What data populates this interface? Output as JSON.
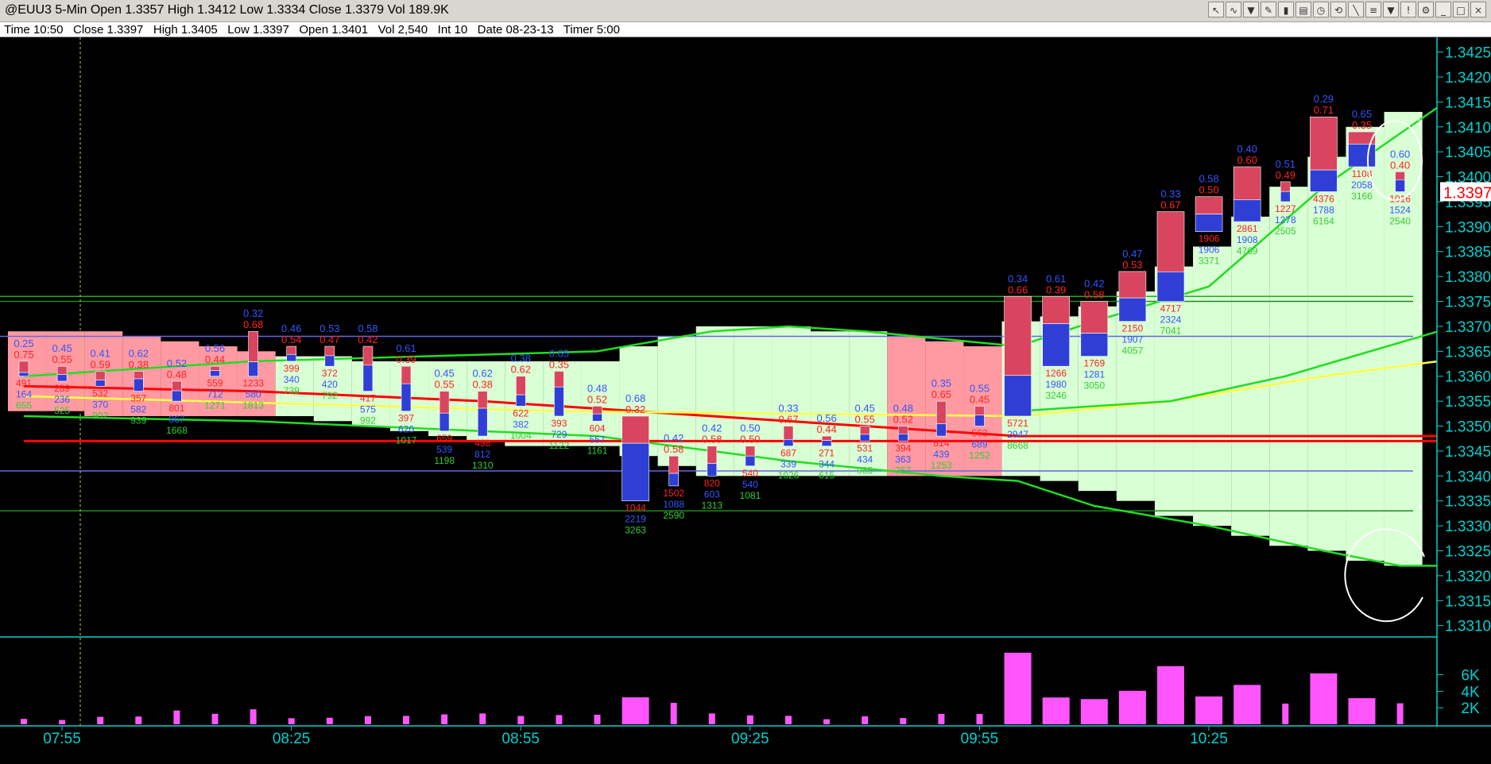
{
  "window": {
    "title": "@EUU3 5-Min Open 1.3357 High 1.3412 Low 1.3334 Close 1.3379 Vol 189.9K",
    "toolbar_icons": [
      "cursor-icon",
      "draw-icon",
      "indicator-icon",
      "pencil-icon",
      "bar-style-icon",
      "chart-type-icon",
      "clock-icon",
      "replay-icon",
      "line-icon",
      "fibonacci-icon",
      "delete-icon",
      "exclamation-icon",
      "settings-icon",
      "minimize-icon",
      "restore-icon",
      "close-icon"
    ]
  },
  "infobar": {
    "text": "Time 10:50   Close 1.3397   High 1.3405   Low 1.3397   Open 1.3401   Vol 2,540   Int 10   Date 08-23-13   Timer 5:00"
  },
  "colors": {
    "background": "#000000",
    "up_red": "#d9455f",
    "down_blue": "#2f3fd6",
    "value_area_green": "#d9ffd4",
    "value_area_red": "#ff9aa2",
    "vwap_red": "#ff0000",
    "ma_green": "#22dd22",
    "ma_yellow": "#ffff44",
    "volume_magenta": "#ff55ff",
    "axis_cyan": "#00d0d0",
    "current_price": "#ff0000"
  },
  "chart_data": {
    "type": "candlestick",
    "title": "@EUU3 5-Min",
    "x_tick_labels": [
      "07:55",
      "08:25",
      "08:55",
      "09:25",
      "09:55",
      "10:25"
    ],
    "price_axis": {
      "ticks": [
        "1.3425",
        "1.3420",
        "1.3415",
        "1.3410",
        "1.3405",
        "1.3400",
        "1.3395",
        "1.3390",
        "1.3385",
        "1.3380",
        "1.3375",
        "1.3370",
        "1.3365",
        "1.3360",
        "1.3355",
        "1.3350",
        "1.3345",
        "1.3340",
        "1.3335",
        "1.3330",
        "1.3325",
        "1.3320",
        "1.3315",
        "1.3310"
      ],
      "range": [
        1.3309,
        1.3427
      ],
      "current_price": "1.3397"
    },
    "volume_axis": {
      "ticks": [
        "6K",
        "4K",
        "2K"
      ],
      "range": [
        0,
        10000
      ]
    },
    "bars": [
      {
        "time": "07:55",
        "open": 1.3363,
        "high": 1.3363,
        "low": 1.3358,
        "close": 1.336,
        "r1": "0.25",
        "r2": "0.75",
        "n1": "491",
        "n2": "164",
        "n3": "655",
        "vol": 655
      },
      {
        "time": "08:00",
        "open": 1.3362,
        "high": 1.3362,
        "low": 1.3358,
        "close": 1.3359,
        "r1": "0.45",
        "r2": "0.55",
        "n1": "289",
        "n2": "236",
        "n3": "525",
        "vol": 525
      },
      {
        "time": "08:05",
        "open": 1.3361,
        "high": 1.3361,
        "low": 1.3357,
        "close": 1.3358,
        "r1": "0.41",
        "r2": "0.59",
        "n1": "532",
        "n2": "370",
        "n3": "902",
        "vol": 902
      },
      {
        "time": "08:10",
        "open": 1.3361,
        "high": 1.3361,
        "low": 1.3356,
        "close": 1.3357,
        "r1": "0.62",
        "r2": "0.38",
        "n1": "357",
        "n2": "582",
        "n3": "939",
        "vol": 939
      },
      {
        "time": "08:15",
        "open": 1.3359,
        "high": 1.3359,
        "low": 1.3354,
        "close": 1.3355,
        "r1": "0.52",
        "r2": "0.48",
        "n1": "801",
        "n2": "867",
        "n3": "1668",
        "vol": 1668
      },
      {
        "time": "08:20",
        "open": 1.3362,
        "high": 1.3364,
        "low": 1.3357,
        "close": 1.336,
        "r1": "0.56",
        "r2": "0.44",
        "n1": "559",
        "n2": "712",
        "n3": "1271",
        "vol": 1271
      },
      {
        "time": "08:25",
        "open": 1.3369,
        "high": 1.3369,
        "low": 1.3357,
        "close": 1.336,
        "r1": "0.32",
        "r2": "0.68",
        "n1": "1233",
        "n2": "580",
        "n3": "1813",
        "vol": 1813
      },
      {
        "time": "08:30",
        "open": 1.3366,
        "high": 1.3366,
        "low": 1.3362,
        "close": 1.3363,
        "r1": "0.46",
        "r2": "0.54",
        "n1": "399",
        "n2": "340",
        "n3": "739",
        "vol": 739
      },
      {
        "time": "08:35",
        "open": 1.3366,
        "high": 1.3366,
        "low": 1.336,
        "close": 1.3362,
        "r1": "0.53",
        "r2": "0.47",
        "n1": "372",
        "n2": "420",
        "n3": "792",
        "vol": 792
      },
      {
        "time": "08:40",
        "open": 1.3366,
        "high": 1.3366,
        "low": 1.3356,
        "close": 1.3357,
        "r1": "0.58",
        "r2": "0.42",
        "n1": "417",
        "n2": "575",
        "n3": "992",
        "vol": 992
      },
      {
        "time": "08:45",
        "open": 1.3362,
        "high": 1.3362,
        "low": 1.3351,
        "close": 1.3353,
        "r1": "0.61",
        "r2": "0.39",
        "n1": "397",
        "n2": "620",
        "n3": "1017",
        "vol": 1017
      },
      {
        "time": "08:50",
        "open": 1.3357,
        "high": 1.3357,
        "low": 1.3347,
        "close": 1.3349,
        "r1": "0.45",
        "r2": "0.55",
        "n1": "659",
        "n2": "539",
        "n3": "1198",
        "vol": 1198
      },
      {
        "time": "08:55",
        "open": 1.3357,
        "high": 1.3357,
        "low": 1.3347,
        "close": 1.3348,
        "r1": "0.62",
        "r2": "0.38",
        "n1": "498",
        "n2": "812",
        "n3": "1310",
        "vol": 1310
      },
      {
        "time": "09:00",
        "open": 1.336,
        "high": 1.336,
        "low": 1.3353,
        "close": 1.3354,
        "r1": "0.38",
        "r2": "0.62",
        "n1": "622",
        "n2": "382",
        "n3": "1004",
        "vol": 1004
      },
      {
        "time": "09:05",
        "open": 1.3361,
        "high": 1.3361,
        "low": 1.3351,
        "close": 1.3352,
        "r1": "0.65",
        "r2": "0.35",
        "n1": "393",
        "n2": "729",
        "n3": "1122",
        "vol": 1122
      },
      {
        "time": "09:10",
        "open": 1.3354,
        "high": 1.3354,
        "low": 1.335,
        "close": 1.3351,
        "r1": "0.48",
        "r2": "0.52",
        "n1": "604",
        "n2": "557",
        "n3": "1161",
        "vol": 1161
      },
      {
        "time": "09:15",
        "open": 1.3352,
        "high": 1.3352,
        "low": 1.3335,
        "close": 1.3335,
        "r1": "0.68",
        "r2": "0.32",
        "n1": "1044",
        "n2": "2219",
        "n3": "3263",
        "vol": 3263
      },
      {
        "time": "09:20",
        "open": 1.3344,
        "high": 1.3344,
        "low": 1.3336,
        "close": 1.3338,
        "r1": "0.42",
        "r2": "0.58",
        "n1": "1502",
        "n2": "1088",
        "n3": "2590",
        "vol": 2590
      },
      {
        "time": "09:25",
        "open": 1.3346,
        "high": 1.3346,
        "low": 1.3339,
        "close": 1.334,
        "r1": "0.42",
        "r2": "0.58",
        "n1": "820",
        "n2": "603",
        "n3": "1313",
        "vol": 1313
      },
      {
        "time": "09:30",
        "open": 1.3346,
        "high": 1.3346,
        "low": 1.334,
        "close": 1.3342,
        "r1": "0.50",
        "r2": "0.50",
        "n1": "540",
        "n2": "540",
        "n3": "1081",
        "vol": 1081
      },
      {
        "time": "09:35",
        "open": 1.335,
        "high": 1.335,
        "low": 1.3345,
        "close": 1.3346,
        "r1": "0.33",
        "r2": "0.67",
        "n1": "687",
        "n2": "339",
        "n3": "1026",
        "vol": 1026
      },
      {
        "time": "09:40",
        "open": 1.3348,
        "high": 1.3348,
        "low": 1.3345,
        "close": 1.3346,
        "r1": "0.56",
        "r2": "0.44",
        "n1": "271",
        "n2": "344",
        "n3": "615",
        "vol": 615
      },
      {
        "time": "09:45",
        "open": 1.335,
        "high": 1.335,
        "low": 1.3346,
        "close": 1.3347,
        "r1": "0.45",
        "r2": "0.55",
        "n1": "531",
        "n2": "434",
        "n3": "965",
        "vol": 965
      },
      {
        "time": "09:50",
        "open": 1.335,
        "high": 1.335,
        "low": 1.3346,
        "close": 1.3347,
        "r1": "0.48",
        "r2": "0.52",
        "n1": "394",
        "n2": "363",
        "n3": "757",
        "vol": 757
      },
      {
        "time": "09:55",
        "open": 1.3355,
        "high": 1.3355,
        "low": 1.3347,
        "close": 1.3348,
        "r1": "0.35",
        "r2": "0.65",
        "n1": "814",
        "n2": "439",
        "n3": "1253",
        "vol": 1253
      },
      {
        "time": "10:00",
        "open": 1.3354,
        "high": 1.3354,
        "low": 1.3349,
        "close": 1.335,
        "r1": "0.55",
        "r2": "0.45",
        "n1": "563",
        "n2": "689",
        "n3": "1252",
        "vol": 1252
      },
      {
        "time": "10:05",
        "open": 1.3352,
        "high": 1.3376,
        "low": 1.3352,
        "close": 1.3376,
        "r1": "0.34",
        "r2": "0.66",
        "n1": "5721",
        "n2": "2947",
        "n3": "8668",
        "vol": 8668
      },
      {
        "time": "10:10",
        "open": 1.3362,
        "high": 1.3376,
        "low": 1.3362,
        "close": 1.3376,
        "r1": "0.61",
        "r2": "0.39",
        "n1": "1266",
        "n2": "1980",
        "n3": "3246",
        "vol": 3246
      },
      {
        "time": "10:15",
        "open": 1.3364,
        "high": 1.3375,
        "low": 1.3364,
        "close": 1.3375,
        "r1": "0.42",
        "r2": "0.58",
        "n1": "1769",
        "n2": "1281",
        "n3": "3050",
        "vol": 3050
      },
      {
        "time": "10:20",
        "open": 1.3371,
        "high": 1.3381,
        "low": 1.3371,
        "close": 1.3381,
        "r1": "0.47",
        "r2": "0.53",
        "n1": "2150",
        "n2": "1907",
        "n3": "4057",
        "vol": 4057
      },
      {
        "time": "10:25",
        "open": 1.3375,
        "high": 1.3393,
        "low": 1.3375,
        "close": 1.3393,
        "r1": "0.33",
        "r2": "0.67",
        "n1": "4717",
        "n2": "2324",
        "n3": "7041",
        "vol": 7041
      },
      {
        "time": "10:30",
        "open": 1.3389,
        "high": 1.3396,
        "low": 1.3389,
        "close": 1.3396,
        "r1": "0.58",
        "r2": "0.50",
        "n1": "1906",
        "n2": "1906",
        "n3": "3371",
        "vol": 3371
      },
      {
        "time": "10:35",
        "open": 1.3391,
        "high": 1.3402,
        "low": 1.3391,
        "close": 1.3402,
        "r1": "0.40",
        "r2": "0.60",
        "n1": "2861",
        "n2": "1908",
        "n3": "4769",
        "vol": 4769
      },
      {
        "time": "10:40",
        "open": 1.3395,
        "high": 1.3399,
        "low": 1.3395,
        "close": 1.3399,
        "r1": "0.51",
        "r2": "0.49",
        "n1": "1227",
        "n2": "1278",
        "n3": "2505",
        "vol": 2505
      },
      {
        "time": "10:45",
        "open": 1.3397,
        "high": 1.3412,
        "low": 1.3397,
        "close": 1.3412,
        "r1": "0.29",
        "r2": "0.71",
        "n1": "4376",
        "n2": "1788",
        "n3": "6164",
        "vol": 6164
      },
      {
        "time": "10:50",
        "open": 1.3402,
        "high": 1.3409,
        "low": 1.3402,
        "close": 1.3409,
        "r1": "0.65",
        "r2": "0.35",
        "n1": "1108",
        "n2": "2058",
        "n3": "3166",
        "vol": 3166
      },
      {
        "time": "10:55",
        "open": 1.3401,
        "high": 1.3401,
        "low": 1.3394,
        "close": 1.3397,
        "r1": "0.60",
        "r2": "0.40",
        "n1": "1016",
        "n2": "1524",
        "n3": "2540",
        "vol": 2540
      }
    ],
    "line_series": [
      {
        "color": "vwap_red",
        "values": [
          [
            0,
            1.3358
          ],
          [
            6,
            1.3357
          ],
          [
            12,
            1.3355
          ],
          [
            18,
            1.3352
          ],
          [
            24,
            1.3349
          ],
          [
            26,
            1.3348
          ],
          [
            37,
            1.3348
          ]
        ]
      },
      {
        "color": "vwap_red",
        "values": [
          [
            0,
            1.3347
          ],
          [
            37,
            1.3347
          ]
        ]
      },
      {
        "color": "ma_yellow",
        "values": [
          [
            0,
            1.3356
          ],
          [
            14,
            1.3353
          ],
          [
            26,
            1.3352
          ],
          [
            30,
            1.3355
          ],
          [
            34,
            1.336
          ],
          [
            37,
            1.3363
          ]
        ]
      },
      {
        "color": "ma_green",
        "values": [
          [
            0,
            1.3352
          ],
          [
            6,
            1.3351
          ],
          [
            15,
            1.3348
          ],
          [
            20,
            1.3343
          ],
          [
            24,
            1.334
          ],
          [
            26,
            1.3339
          ],
          [
            28,
            1.3334
          ],
          [
            31,
            1.333
          ],
          [
            34,
            1.3325
          ],
          [
            36,
            1.3322
          ],
          [
            37,
            1.3322
          ]
        ]
      },
      {
        "color": "ma_green",
        "values": [
          [
            0,
            1.336
          ],
          [
            6,
            1.3363
          ],
          [
            15,
            1.3365
          ],
          [
            18,
            1.3369
          ],
          [
            20,
            1.337
          ],
          [
            22,
            1.3369
          ],
          [
            26,
            1.3366
          ],
          [
            28,
            1.3371
          ],
          [
            31,
            1.3378
          ],
          [
            34,
            1.3398
          ],
          [
            37,
            1.3414
          ]
        ]
      },
      {
        "color": "ma_green",
        "values": [
          [
            26,
            1.3353
          ],
          [
            30,
            1.3355
          ],
          [
            33,
            1.336
          ],
          [
            37,
            1.3369
          ]
        ]
      }
    ],
    "horizontal_lines": [
      {
        "price": 1.3376,
        "color": "#22aa22"
      },
      {
        "price": 1.3375,
        "color": "#1e8a1e"
      },
      {
        "price": 1.3368,
        "color": "#6666dd"
      },
      {
        "price": 1.3341,
        "color": "#6666dd"
      },
      {
        "price": 1.3333,
        "color": "#1e8a1e"
      }
    ],
    "right_markers": [
      "2",
      "4",
      "4"
    ]
  }
}
